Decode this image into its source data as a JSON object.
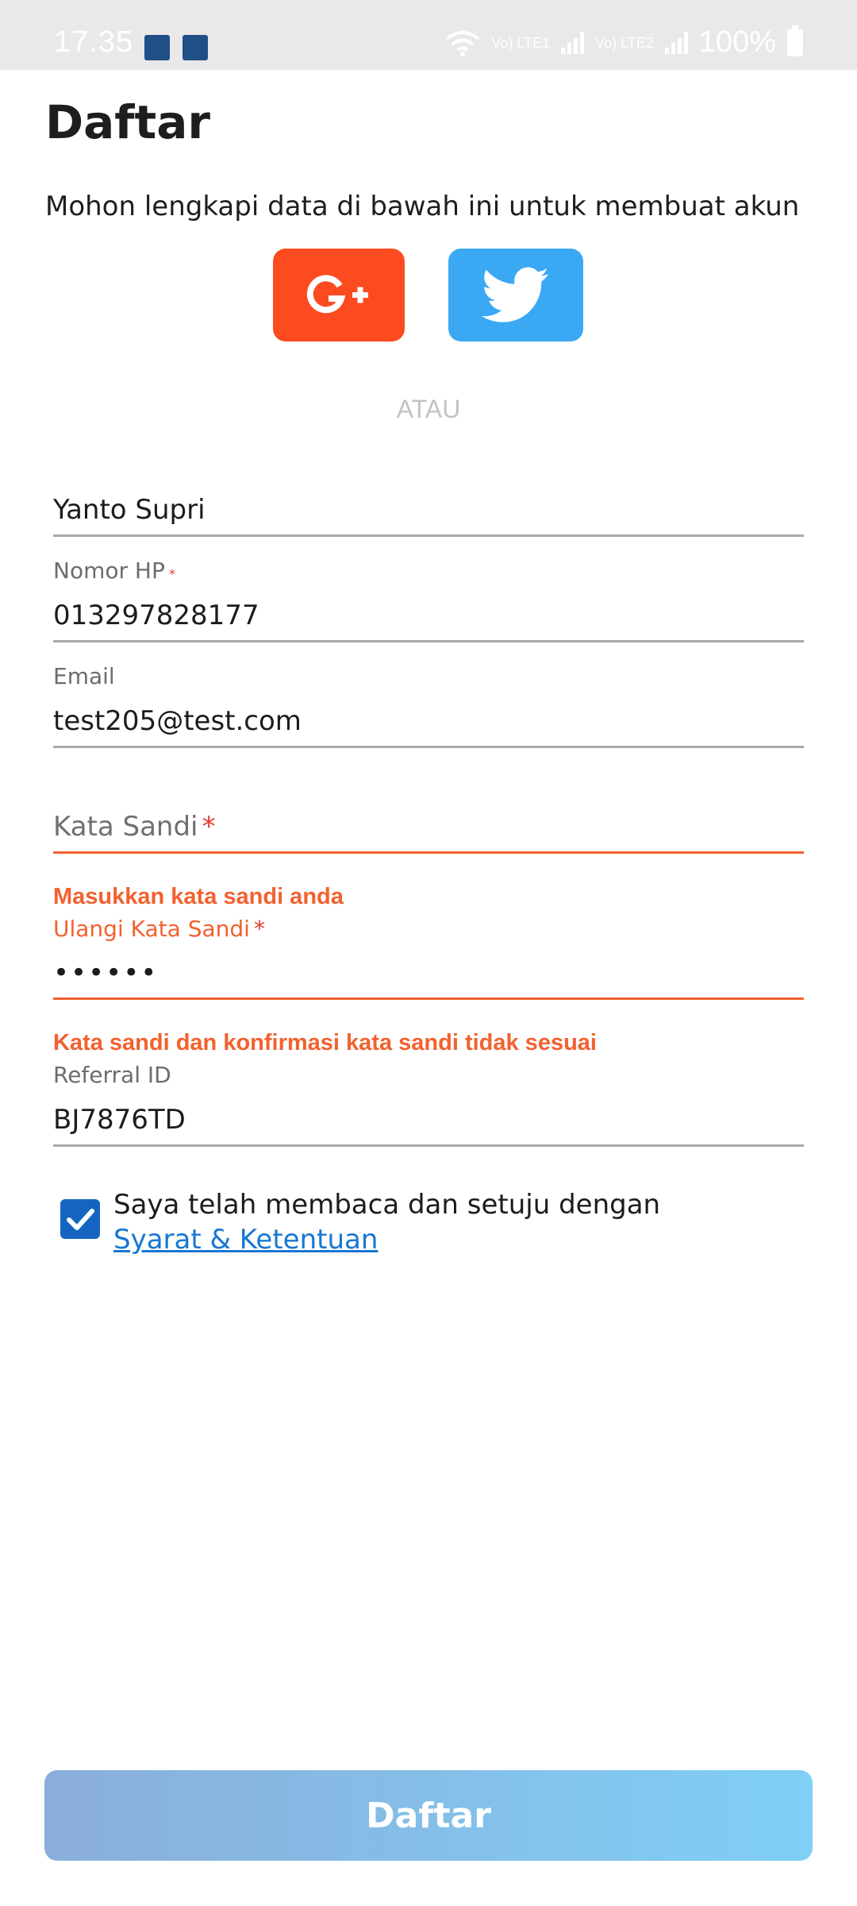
{
  "status_bar": {
    "time": "17.35",
    "sim1": "Vo) LTE1",
    "sim2": "Vo) LTE2",
    "battery": "100%"
  },
  "page": {
    "title": "Daftar",
    "subtitle": "Mohon lengkapi data di bawah ini untuk membuat akun",
    "separator": "ATAU"
  },
  "social": {
    "google_text": "G+",
    "google_color": "#fb4b1f",
    "twitter_color": "#3aa8f3",
    "twitter_icon": "twitter-bird-icon"
  },
  "form": {
    "name": {
      "value": "Yanto Supri"
    },
    "phone": {
      "label": "Nomor HP",
      "required": "*",
      "value": "013297828177"
    },
    "email": {
      "label": "Email",
      "value": "test205@test.com"
    },
    "password": {
      "placeholder": "Kata Sandi",
      "required": "*",
      "error": "Masukkan kata sandi anda"
    },
    "confirm_password": {
      "label": "Ulangi Kata Sandi",
      "required": "*",
      "value": "••••••",
      "error": "Kata sandi dan konfirmasi kata sandi tidak sesuai"
    },
    "referral": {
      "label": "Referral ID",
      "value": "BJ7876TD"
    }
  },
  "terms": {
    "checked": true,
    "text": "Saya telah membaca dan setuju dengan",
    "link": " Syarat & Ketentuan"
  },
  "submit": {
    "label": "Daftar"
  },
  "colors": {
    "accent_error": "#f2612e",
    "link": "#1976d2",
    "checkbox": "#1565c0"
  }
}
